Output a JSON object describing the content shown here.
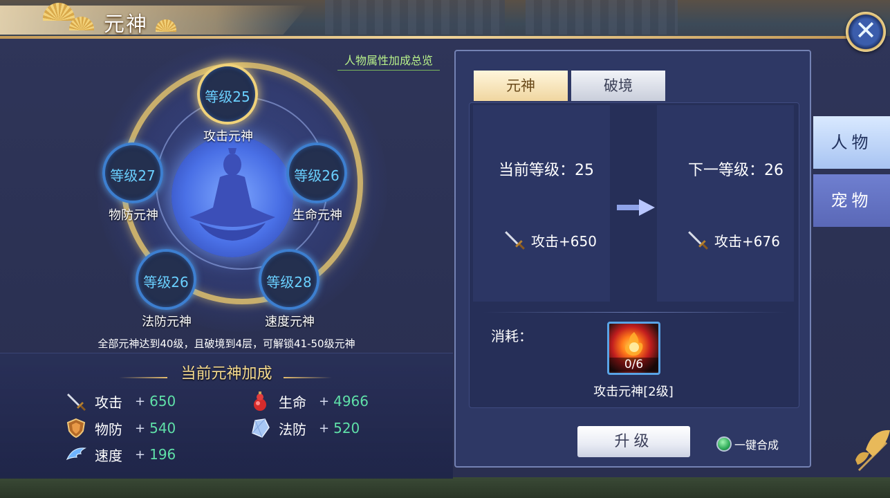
{
  "header": {
    "title": "元神",
    "close_icon": "close-icon"
  },
  "left": {
    "overview_link": "人物属性加成总览",
    "nodes": [
      {
        "level": "等级25",
        "name": "攻击元神",
        "active": true
      },
      {
        "level": "等级27",
        "name": "物防元神",
        "active": false
      },
      {
        "level": "等级26",
        "name": "生命元神",
        "active": false
      },
      {
        "level": "等级26",
        "name": "法防元神",
        "active": false
      },
      {
        "level": "等级28",
        "name": "速度元神",
        "active": false
      }
    ],
    "unlock_note": "全部元神达到40级，且破境到4层，可解锁41-50级元神",
    "bonus": {
      "title": "当前元神加成",
      "stats": [
        {
          "icon": "sword-icon",
          "label": "攻击",
          "plus": "+",
          "value": "650"
        },
        {
          "icon": "gourd-icon",
          "label": "生命",
          "plus": "+",
          "value": "4966"
        },
        {
          "icon": "shield-icon",
          "label": "物防",
          "plus": "+",
          "value": "540"
        },
        {
          "icon": "crystal-icon",
          "label": "法防",
          "plus": "+",
          "value": "520"
        },
        {
          "icon": "wing-icon",
          "label": "速度",
          "plus": "+",
          "value": "196"
        }
      ]
    }
  },
  "right": {
    "tabs": [
      {
        "label": "元神",
        "active": true
      },
      {
        "label": "破境",
        "active": false
      }
    ],
    "current_level": "当前等级：25",
    "next_level": "下一等级：26",
    "current_attack": "攻击+650",
    "next_attack": "攻击+676",
    "cost_label": "消耗：",
    "item": {
      "count": "0/6",
      "name": "攻击元神[2级]",
      "icon": "flame-orb-icon"
    },
    "upgrade_button": "升级",
    "one_key": "一键合成"
  },
  "side_tabs": [
    {
      "label": "人物",
      "active": true
    },
    {
      "label": "宠物",
      "active": false
    }
  ],
  "colors": {
    "panel_bg": "#2b3153",
    "gold": "#f0d27a",
    "node_level": "#6ad0ff",
    "stat_value": "#5fe0a8",
    "link_green": "#b8f28a"
  }
}
